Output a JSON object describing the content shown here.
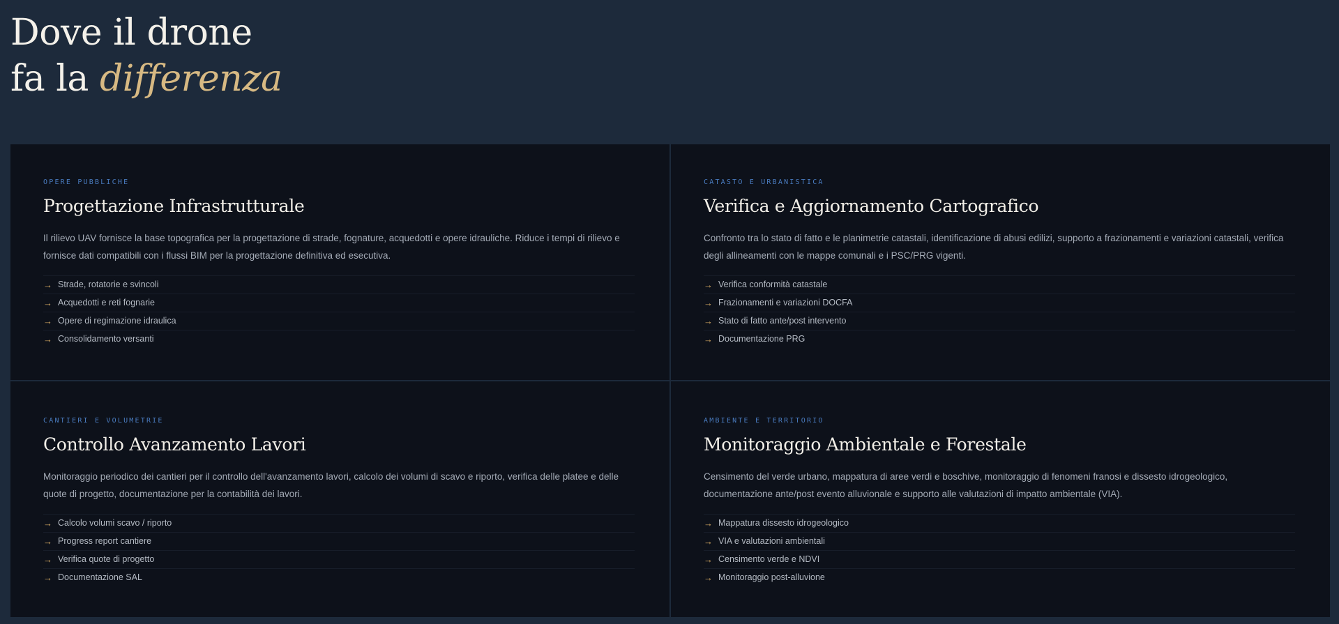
{
  "hero": {
    "line1": "Dove il drone",
    "line2_prefix": "fa la ",
    "line2_accent": "differenza"
  },
  "colors": {
    "page_background": "#1d2a3b",
    "card_background": "#0d111a",
    "accent_gold": "#d7b983",
    "arrow": "#d4a862",
    "category_blue": "#4a7cc0"
  },
  "cards": [
    {
      "category": "OPERE PUBBLICHE",
      "title": "Progettazione Infrastrutturale",
      "description": "Il rilievo UAV fornisce la base topografica per la progettazione di strade, fognature, acquedotti e opere idrauliche. Riduce i tempi di rilievo e fornisce dati compatibili con i flussi BIM per la progettazione definitiva ed esecutiva.",
      "items": [
        "Strade, rotatorie e svincoli",
        "Acquedotti e reti fognarie",
        "Opere di regimazione idraulica",
        "Consolidamento versanti"
      ]
    },
    {
      "category": "CATASTO E URBANISTICA",
      "title": "Verifica e Aggiornamento Cartografico",
      "description": "Confronto tra lo stato di fatto e le planimetrie catastali, identificazione di abusi edilizi, supporto a frazionamenti e variazioni catastali, verifica degli allineamenti con le mappe comunali e i PSC/PRG vigenti.",
      "items": [
        "Verifica conformità catastale",
        "Frazionamenti e variazioni DOCFA",
        "Stato di fatto ante/post intervento",
        "Documentazione PRG"
      ]
    },
    {
      "category": "CANTIERI E VOLUMETRIE",
      "title": "Controllo Avanzamento Lavori",
      "description": "Monitoraggio periodico dei cantieri per il controllo dell'avanzamento lavori, calcolo dei volumi di scavo e riporto, verifica delle platee e delle quote di progetto, documentazione per la contabilità dei lavori.",
      "items": [
        "Calcolo volumi scavo / riporto",
        "Progress report cantiere",
        "Verifica quote di progetto",
        "Documentazione SAL"
      ]
    },
    {
      "category": "AMBIENTE E TERRITORIO",
      "title": "Monitoraggio Ambientale e Forestale",
      "description": "Censimento del verde urbano, mappatura di aree verdi e boschive, monitoraggio di fenomeni franosi e dissesto idrogeologico, documentazione ante/post evento alluvionale e supporto alle valutazioni di impatto ambientale (VIA).",
      "items": [
        "Mappatura dissesto idrogeologico",
        "VIA e valutazioni ambientali",
        "Censimento verde e NDVI",
        "Monitoraggio post-alluvione"
      ]
    }
  ],
  "list_icon": "arrow-right-icon",
  "arrow_glyph": "→"
}
